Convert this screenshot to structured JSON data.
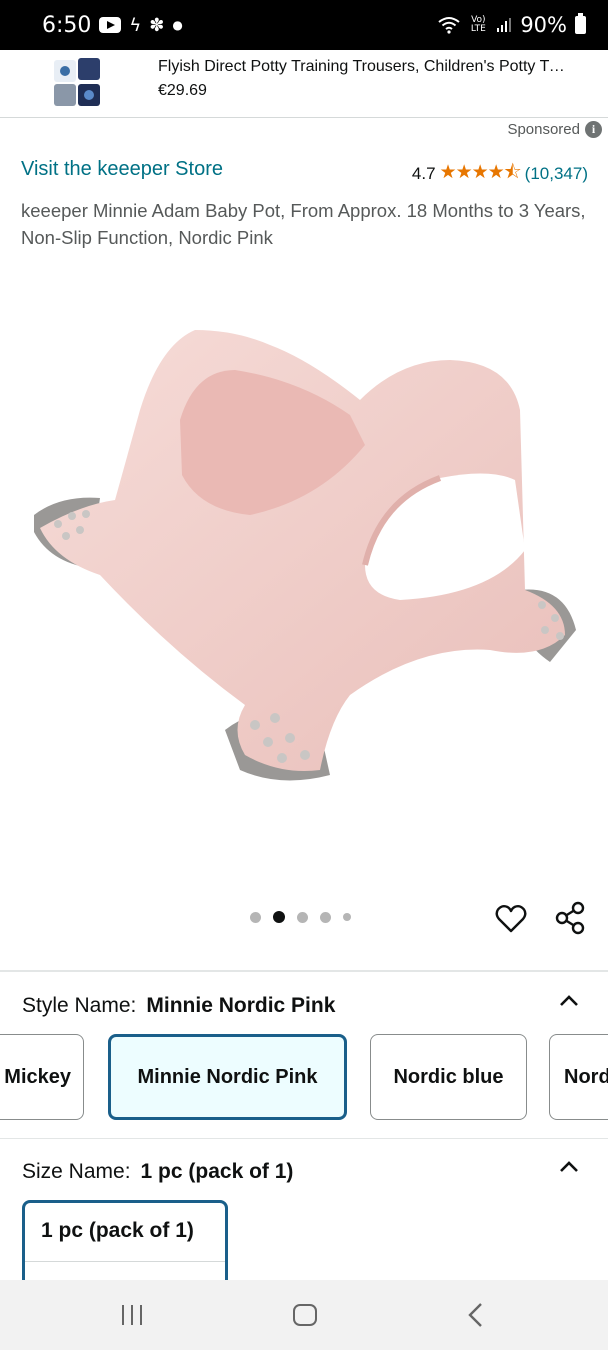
{
  "status_bar": {
    "time": "6:50",
    "network_label": "Vo) LTE",
    "battery": "90%"
  },
  "ad": {
    "title": "Flyish Direct Potty Training Trousers, Children's Potty Training Pants",
    "price": "€29.69",
    "sponsored": "Sponsored"
  },
  "product": {
    "store_link": "Visit the keeeper Store",
    "rating_value": "4.7",
    "stars": "★★★★⯪",
    "rating_count": "(10,347)",
    "title": "keeeper Minnie Adam Baby Pot, From Approx. 18 Months to 3 Years, Non-Slip Function, Nordic Pink"
  },
  "carousel": {
    "total_dots": 5,
    "active_index": 1
  },
  "style": {
    "label": "Style Name:",
    "selected": "Minnie Nordic Pink",
    "options": [
      "Mickey",
      "Minnie Nordic Pink",
      "Nordic blue",
      "Nordic"
    ]
  },
  "size": {
    "label": "Size Name:",
    "selected": "1 pc (pack of 1)",
    "options": [
      "1 pc (pack of 1)"
    ]
  },
  "colors": {
    "link": "#007185",
    "star": "#e77600",
    "selected_border": "#1a5f8a",
    "selected_bg": "#edfdff",
    "product_pink": "#f2cfcb",
    "foot_grey": "#9a9896"
  }
}
